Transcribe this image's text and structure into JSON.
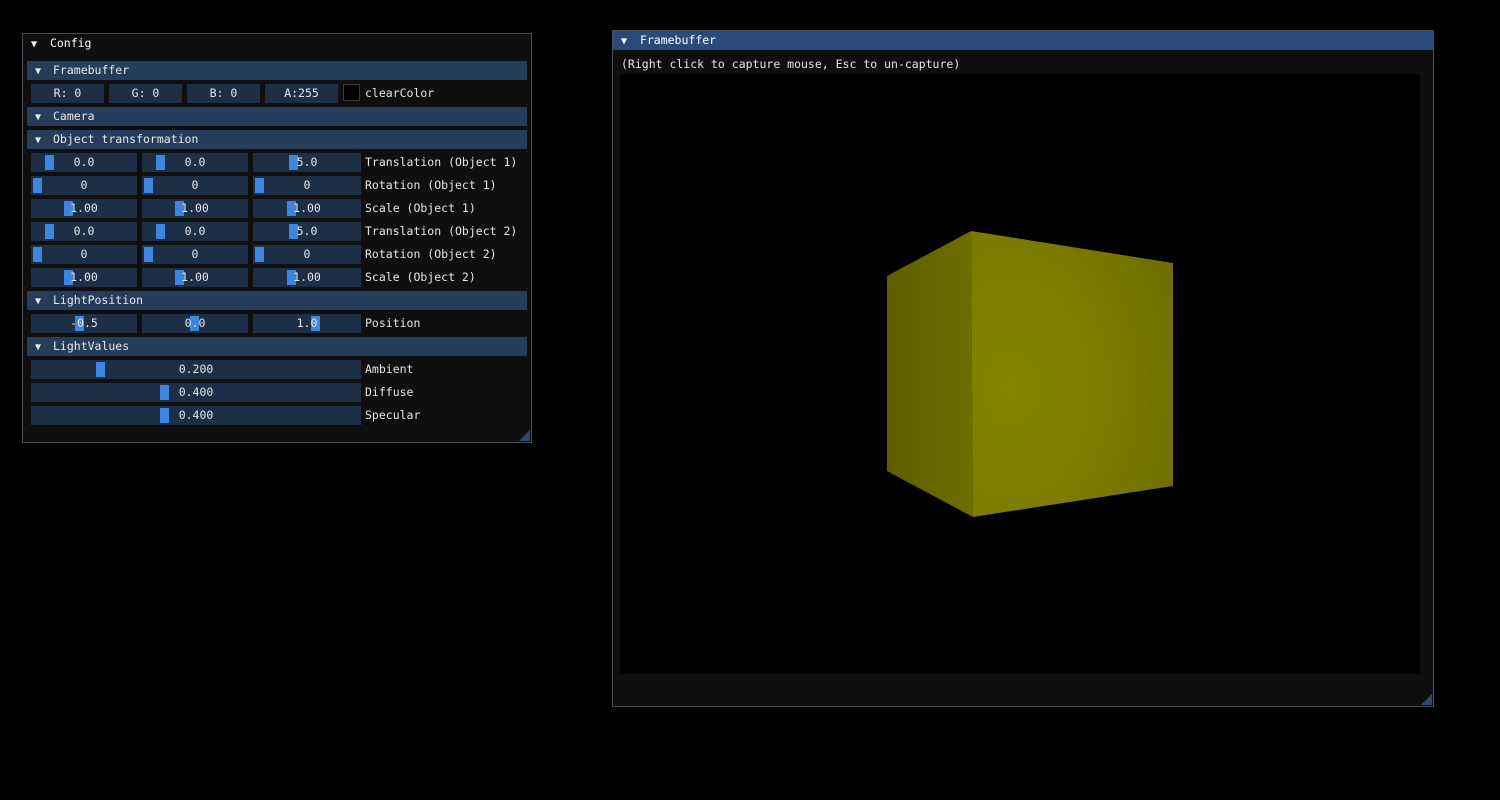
{
  "config_window": {
    "title": "Config",
    "framebuffer": {
      "header": "Framebuffer",
      "r_label": "R:  0",
      "g_label": "G:  0",
      "b_label": "B:  0",
      "a_label": "A:255",
      "clear_color_label": "clearColor"
    },
    "camera": {
      "header": "Camera"
    },
    "object_transformation": {
      "header": "Object transformation",
      "rows": [
        {
          "values": [
            "0.0",
            "0.0",
            "5.0"
          ],
          "label": "Translation (Object 1)"
        },
        {
          "values": [
            "0",
            "0",
            "0"
          ],
          "label": "Rotation (Object 1)"
        },
        {
          "values": [
            "1.00",
            "1.00",
            "1.00"
          ],
          "label": "Scale (Object 1)"
        },
        {
          "values": [
            "0.0",
            "0.0",
            "5.0"
          ],
          "label": "Translation (Object 2)"
        },
        {
          "values": [
            "0",
            "0",
            "0"
          ],
          "label": "Rotation (Object 2)"
        },
        {
          "values": [
            "1.00",
            "1.00",
            "1.00"
          ],
          "label": "Scale (Object 2)"
        }
      ]
    },
    "light_position": {
      "header": "LightPosition",
      "values": [
        "-0.5",
        "0.0",
        "1.0"
      ],
      "label": "Position"
    },
    "light_values": {
      "header": "LightValues",
      "sliders": [
        {
          "value": "0.200",
          "label": "Ambient"
        },
        {
          "value": "0.400",
          "label": "Diffuse"
        },
        {
          "value": "0.400",
          "label": "Specular"
        }
      ]
    }
  },
  "framebuffer_window": {
    "title": "Framebuffer",
    "hint": "(Right click to capture mouse, Esc to un-capture)"
  },
  "colors": {
    "accent": "#3d85e0",
    "header_bg": "#253c5a",
    "field_bg": "#1d2f47",
    "titlebar_active": "#294a7a",
    "cube_color": "#808000"
  }
}
